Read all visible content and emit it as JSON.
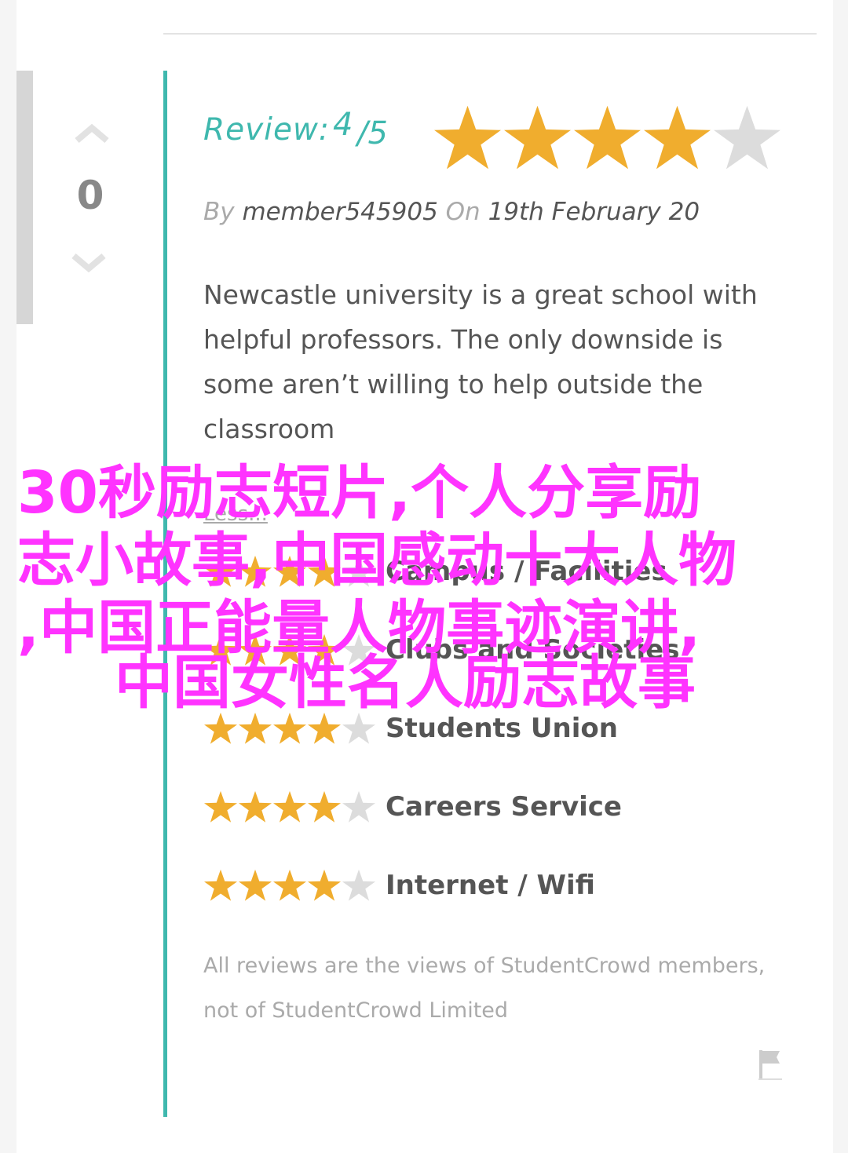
{
  "vote": {
    "count": "0"
  },
  "review": {
    "label": "Review:",
    "score": "4",
    "max": "/5",
    "rating": 4,
    "out_of": 5,
    "by_label": "By",
    "author": "member545905",
    "on_label": "On",
    "date": "19th February 20",
    "text": "Newcastle university is a great school with helpful professors. The only downside is some aren’t willing to help outside the classroom",
    "less_link": "Less..."
  },
  "category_ratings": [
    {
      "name": "Campus / Facilities",
      "rating": 4
    },
    {
      "name": "Clubs and Societies",
      "rating": 4
    },
    {
      "name": "Students Union",
      "rating": 4
    },
    {
      "name": "Careers Service",
      "rating": 4
    },
    {
      "name": "Internet / Wifi",
      "rating": 4
    }
  ],
  "disclaimer": "All reviews are the views of StudentCrowd members, not of StudentCrowd Limited",
  "overlay": {
    "line1": "30秒励志短片,个人分享励",
    "line2": "志小故事,中国感动十大人物",
    "line3": ",中国正能量人物事迹演讲,",
    "line4": "中国女性名人励志故事"
  },
  "colors": {
    "accent": "#3fb8ae",
    "star_filled": "#f0ad2e",
    "star_empty": "#dcdcdc",
    "overlay_text": "#ff33ff"
  },
  "icons": {
    "upvote": "chevron-up-icon",
    "downvote": "chevron-down-icon",
    "report": "flag-icon",
    "star": "star-icon"
  }
}
